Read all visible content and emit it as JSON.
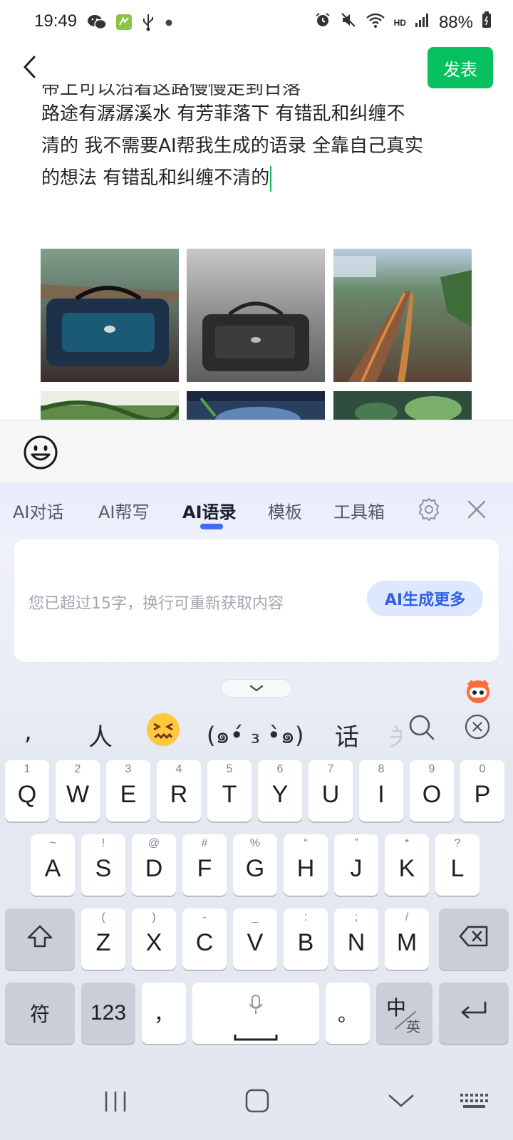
{
  "status_bar": {
    "time": "19:49",
    "icons_left": [
      "wechat-icon",
      "app-icon",
      "usb-icon",
      "dot-icon"
    ],
    "icons_right": [
      "alarm-icon",
      "mute-icon",
      "wifi-icon",
      "hd-icon",
      "signal-icon"
    ],
    "hd_label": "HD",
    "battery": "88%"
  },
  "header": {
    "publish_label": "发表"
  },
  "post": {
    "line_partial": "带上可以沿着这路慢慢走到日落",
    "line1": "  路途有潺潺溪水   有芳菲落下  有错乱和纠缠不",
    "line2": "清的 我不需要AI帮我生成的语录  全靠自己真实",
    "line3": "的想法   有错乱和纠缠不清的"
  },
  "photos": [
    {
      "name": "photo-bag-blue"
    },
    {
      "name": "photo-bag-gray"
    },
    {
      "name": "photo-railway"
    },
    {
      "name": "photo-greenery"
    },
    {
      "name": "photo-water"
    },
    {
      "name": "photo-leaves"
    }
  ],
  "ai_panel": {
    "tabs": [
      "AI对话",
      "AI帮写",
      "AI语录",
      "模板",
      "工具箱"
    ],
    "active_tab": "AI语录",
    "hint": "您已超过15字，换行可重新获取内容",
    "more_button": "AI生成更多"
  },
  "candidates": {
    "items": [
      ",",
      "人",
      "(๑•́ ₃ •̀๑)",
      "话",
      "关"
    ],
    "emoji": "confounded-face-emoji"
  },
  "keyboard": {
    "row1": [
      {
        "key": "Q",
        "sub": "1"
      },
      {
        "key": "W",
        "sub": "2"
      },
      {
        "key": "E",
        "sub": "3"
      },
      {
        "key": "R",
        "sub": "4"
      },
      {
        "key": "T",
        "sub": "5"
      },
      {
        "key": "Y",
        "sub": "6"
      },
      {
        "key": "U",
        "sub": "7"
      },
      {
        "key": "I",
        "sub": "8"
      },
      {
        "key": "O",
        "sub": "9"
      },
      {
        "key": "P",
        "sub": "0"
      }
    ],
    "row2": [
      {
        "key": "A",
        "sub": "~"
      },
      {
        "key": "S",
        "sub": "!"
      },
      {
        "key": "D",
        "sub": "@"
      },
      {
        "key": "F",
        "sub": "#"
      },
      {
        "key": "G",
        "sub": "%"
      },
      {
        "key": "H",
        "sub": "“"
      },
      {
        "key": "J",
        "sub": "”"
      },
      {
        "key": "K",
        "sub": "*"
      },
      {
        "key": "L",
        "sub": "?"
      }
    ],
    "row3": [
      {
        "key": "Z",
        "sub": "("
      },
      {
        "key": "X",
        "sub": ")"
      },
      {
        "key": "C",
        "sub": "-"
      },
      {
        "key": "V",
        "sub": "_"
      },
      {
        "key": "B",
        "sub": ":"
      },
      {
        "key": "N",
        "sub": ";"
      },
      {
        "key": "M",
        "sub": "/"
      }
    ],
    "symbols_label": "符",
    "numbers_label": "123",
    "comma_label": "，",
    "period_label": "。",
    "lang_main": "中",
    "lang_sub": "英"
  }
}
